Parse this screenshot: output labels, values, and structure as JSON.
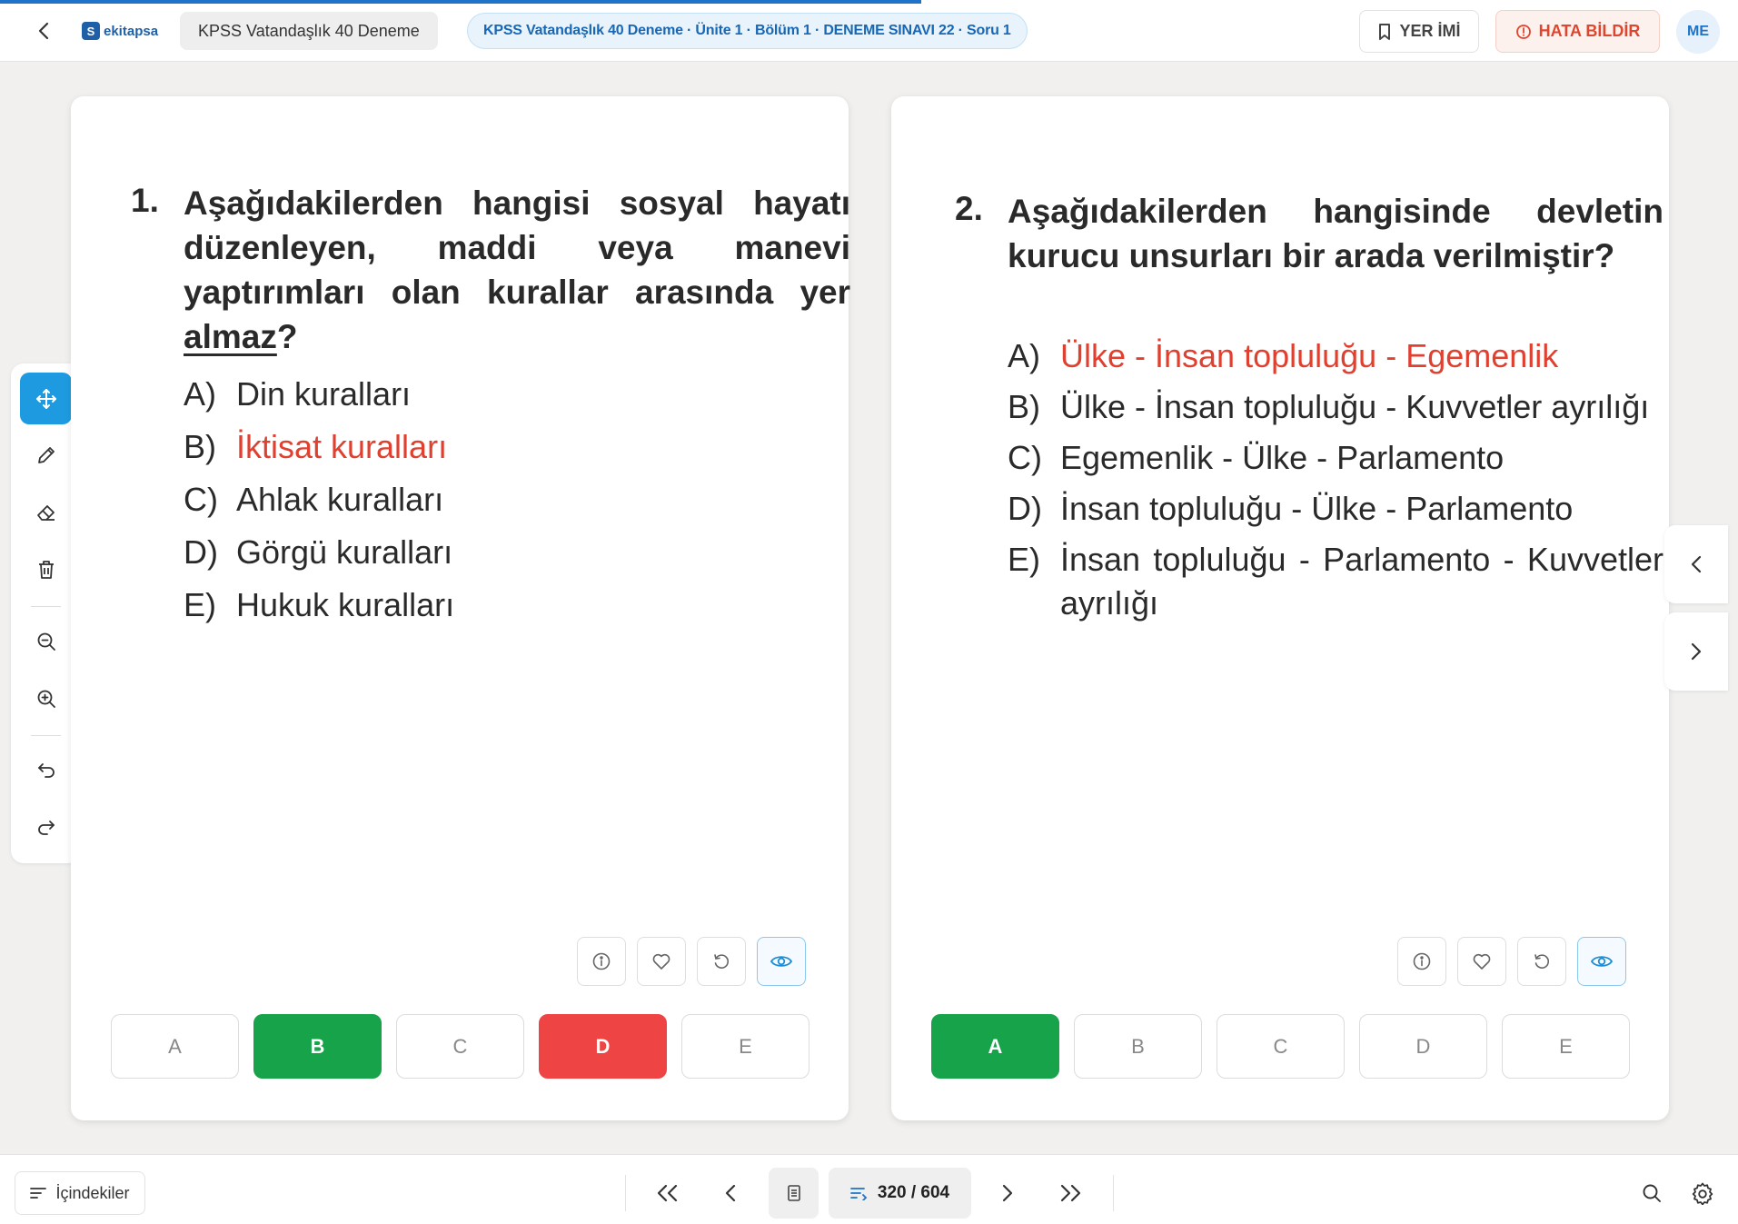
{
  "header": {
    "logo_text": "ekitapsa",
    "logo_mark": "S",
    "book_title": "KPSS Vatandaşlık 40 Deneme",
    "breadcrumb": "KPSS Vatandaşlık 40 Deneme · Ünite 1 · Bölüm 1 · DENEME SINAVI 22 · Soru 1",
    "bookmark_label": "YER İMİ",
    "report_label": "HATA BİLDİR",
    "avatar_initials": "ME",
    "reading_progress": 0.53
  },
  "questions": [
    {
      "number": "1.",
      "text_before": "Aşağıdakilerden hangisi sosyal ha­yatı düzenleyen, maddi veya manevi yaptırımları olan kurallar arasında yer ",
      "text_underlined": "almaz",
      "text_after": "?",
      "options": [
        {
          "letter": "A)",
          "text": "Din kuralları"
        },
        {
          "letter": "B)",
          "text": "İktisat kuralları"
        },
        {
          "letter": "C)",
          "text": "Ahlak kuralları"
        },
        {
          "letter": "D)",
          "text": "Görgü kuralları"
        },
        {
          "letter": "E)",
          "text": "Hukuk kuralları"
        }
      ],
      "answers": [
        "A",
        "B",
        "C",
        "D",
        "E"
      ],
      "correct_answer": "B",
      "selected_wrong": "D"
    },
    {
      "number": "2.",
      "text": "Aşağıdakilerden hangisinde devletin kurucu unsurları bir arada verilmiş­tir?",
      "options": [
        {
          "letter": "A)",
          "text": "Ülke - İnsan topluluğu - Egemenlik"
        },
        {
          "letter": "B)",
          "text": "Ülke - İnsan topluluğu - Kuvvetler ayrılığı"
        },
        {
          "letter": "C)",
          "text": "Egemenlik - Ülke - Parlamento"
        },
        {
          "letter": "D)",
          "text": "İnsan topluluğu - Ülke - Parlamento"
        },
        {
          "letter": "E)",
          "text": "İnsan topluluğu - Parlamento - Kuv­vetler ayrılığı"
        }
      ],
      "answers": [
        "A",
        "B",
        "C",
        "D",
        "E"
      ],
      "correct_answer": "A"
    }
  ],
  "footer": {
    "toc_label": "İçindekiler",
    "page_current": "320",
    "page_total": "604",
    "page_display": "320 / 604"
  },
  "colors": {
    "accent": "#1e9be0",
    "correct": "#16a34a",
    "wrong": "#ef4444",
    "answer_text": "#e0402f",
    "progress": "#1e73c8"
  },
  "icons": {
    "side_tools": [
      "move-icon",
      "pencil-icon",
      "eraser-icon",
      "trash-icon",
      "zoom-out-icon",
      "zoom-in-icon",
      "undo-icon",
      "redo-icon"
    ],
    "card_tools": [
      "info-icon",
      "heart-icon",
      "reset-icon",
      "eye-icon"
    ]
  }
}
